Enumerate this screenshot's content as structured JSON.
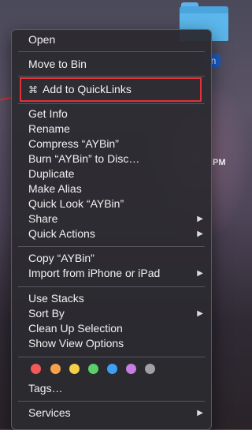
{
  "desktop": {
    "selected_label": "n",
    "clock": "PM"
  },
  "menu": {
    "group1": [
      "Open"
    ],
    "group2": [
      "Move to Bin"
    ],
    "group3": [
      "Add to QuickLinks"
    ],
    "group4": [
      {
        "label": "Get Info"
      },
      {
        "label": "Rename"
      },
      {
        "label": "Compress “AYBin”"
      },
      {
        "label": "Burn “AYBin” to Disc…"
      },
      {
        "label": "Duplicate"
      },
      {
        "label": "Make Alias"
      },
      {
        "label": "Quick Look “AYBin”"
      },
      {
        "label": "Share",
        "submenu": true
      },
      {
        "label": "Quick Actions",
        "submenu": true
      }
    ],
    "group5": [
      {
        "label": "Copy “AYBin”"
      },
      {
        "label": "Import from iPhone or iPad",
        "submenu": true
      }
    ],
    "group6": [
      {
        "label": "Use Stacks"
      },
      {
        "label": "Sort By",
        "submenu": true
      },
      {
        "label": "Clean Up Selection"
      },
      {
        "label": "Show View Options"
      }
    ],
    "tag_colors": [
      "#f25a5a",
      "#f7a24b",
      "#f5cf48",
      "#5ad06b",
      "#3d9ff5",
      "#c77ee0",
      "#a0a0a5"
    ],
    "tags_label": "Tags…",
    "services_label": "Services",
    "submenu_arrow": "▶",
    "quicklinks_icon": "⌘"
  }
}
